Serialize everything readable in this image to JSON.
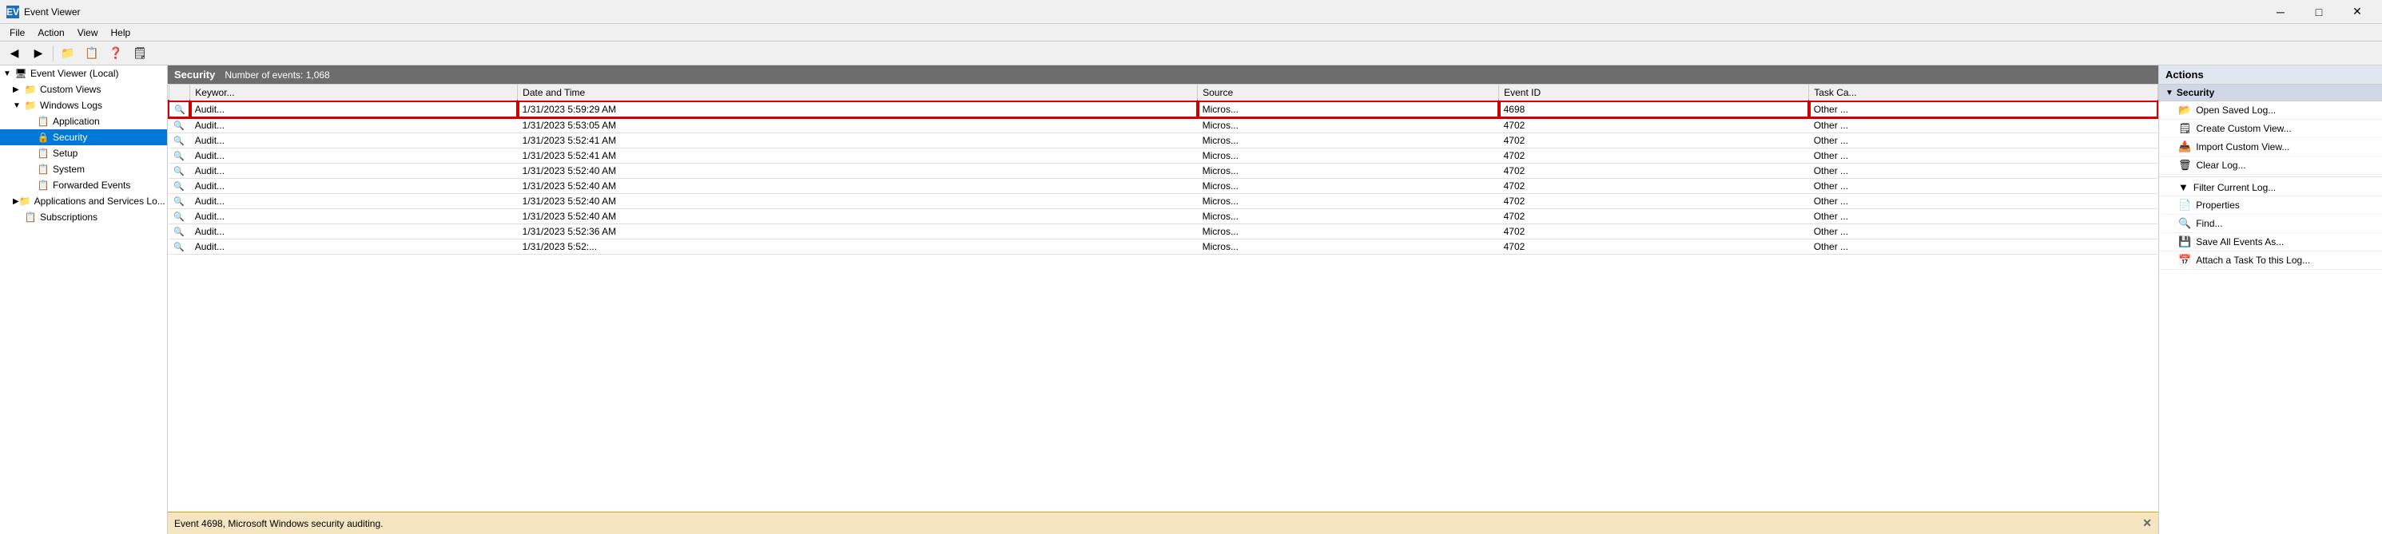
{
  "app": {
    "title": "Event Viewer",
    "icon": "EV"
  },
  "titlebar": {
    "minimize_label": "─",
    "maximize_label": "□",
    "close_label": "✕"
  },
  "menu": {
    "items": [
      "File",
      "Action",
      "View",
      "Help"
    ]
  },
  "toolbar": {
    "buttons": [
      "◀",
      "▶",
      "📁",
      "📋",
      "❓",
      "🗒"
    ]
  },
  "tree": {
    "root": "Event Viewer (Local)",
    "items": [
      {
        "id": "event-viewer-root",
        "label": "Event Viewer (Local)",
        "level": 0,
        "icon": "🖥",
        "expanded": true
      },
      {
        "id": "custom-views",
        "label": "Custom Views",
        "level": 1,
        "icon": "📁",
        "expanded": false
      },
      {
        "id": "windows-logs",
        "label": "Windows Logs",
        "level": 1,
        "icon": "📁",
        "expanded": true
      },
      {
        "id": "application",
        "label": "Application",
        "level": 2,
        "icon": "📋",
        "expanded": false
      },
      {
        "id": "security",
        "label": "Security",
        "level": 2,
        "icon": "🔒",
        "expanded": false,
        "selected": true
      },
      {
        "id": "setup",
        "label": "Setup",
        "level": 2,
        "icon": "📋",
        "expanded": false
      },
      {
        "id": "system",
        "label": "System",
        "level": 2,
        "icon": "📋",
        "expanded": false
      },
      {
        "id": "forwarded-events",
        "label": "Forwarded Events",
        "level": 2,
        "icon": "📋",
        "expanded": false
      },
      {
        "id": "applications-services",
        "label": "Applications and Services Lo...",
        "level": 1,
        "icon": "📁",
        "expanded": false
      },
      {
        "id": "subscriptions",
        "label": "Subscriptions",
        "level": 1,
        "icon": "📋",
        "expanded": false
      }
    ]
  },
  "events_panel": {
    "title": "Security",
    "count_label": "Number of events: 1,068"
  },
  "table": {
    "columns": [
      "Keywor...",
      "Date and Time",
      "Source",
      "Event ID",
      "Task Ca..."
    ],
    "rows": [
      {
        "keyword": "Audit...",
        "datetime": "1/31/2023 5:59:29 AM",
        "source": "Micros...",
        "eventid": "4698",
        "taskcat": "Other ...",
        "selected": true
      },
      {
        "keyword": "Audit...",
        "datetime": "1/31/2023 5:53:05 AM",
        "source": "Micros...",
        "eventid": "4702",
        "taskcat": "Other ...",
        "selected": false
      },
      {
        "keyword": "Audit...",
        "datetime": "1/31/2023 5:52:41 AM",
        "source": "Micros...",
        "eventid": "4702",
        "taskcat": "Other ...",
        "selected": false
      },
      {
        "keyword": "Audit...",
        "datetime": "1/31/2023 5:52:41 AM",
        "source": "Micros...",
        "eventid": "4702",
        "taskcat": "Other ...",
        "selected": false
      },
      {
        "keyword": "Audit...",
        "datetime": "1/31/2023 5:52:40 AM",
        "source": "Micros...",
        "eventid": "4702",
        "taskcat": "Other ...",
        "selected": false
      },
      {
        "keyword": "Audit...",
        "datetime": "1/31/2023 5:52:40 AM",
        "source": "Micros...",
        "eventid": "4702",
        "taskcat": "Other ...",
        "selected": false
      },
      {
        "keyword": "Audit...",
        "datetime": "1/31/2023 5:52:40 AM",
        "source": "Micros...",
        "eventid": "4702",
        "taskcat": "Other ...",
        "selected": false
      },
      {
        "keyword": "Audit...",
        "datetime": "1/31/2023 5:52:40 AM",
        "source": "Micros...",
        "eventid": "4702",
        "taskcat": "Other ...",
        "selected": false
      },
      {
        "keyword": "Audit...",
        "datetime": "1/31/2023 5:52:36 AM",
        "source": "Micros...",
        "eventid": "4702",
        "taskcat": "Other ...",
        "selected": false
      },
      {
        "keyword": "Audit...",
        "datetime": "1/31/2023 5:52:...",
        "source": "Micros...",
        "eventid": "4702",
        "taskcat": "Other ...",
        "selected": false
      }
    ]
  },
  "status_bar": {
    "text": "Event 4698, Microsoft Windows security auditing.",
    "close_icon": "✕"
  },
  "actions": {
    "header": "Actions",
    "section_title": "Security",
    "items": [
      {
        "id": "open-saved-log",
        "label": "Open Saved Log...",
        "icon": "📂"
      },
      {
        "id": "create-custom-view",
        "label": "Create Custom View...",
        "icon": "▼"
      },
      {
        "id": "import-custom-view",
        "label": "Import Custom View...",
        "icon": ""
      },
      {
        "id": "clear-log",
        "label": "Clear Log...",
        "icon": ""
      },
      {
        "id": "filter-current-log",
        "label": "Filter Current Log...",
        "icon": "▼"
      },
      {
        "id": "properties",
        "label": "Properties",
        "icon": "📄"
      },
      {
        "id": "find",
        "label": "Find...",
        "icon": "🔍"
      },
      {
        "id": "save-all-events",
        "label": "Save All Events As...",
        "icon": "💾"
      },
      {
        "id": "attach-task",
        "label": "Attach a Task To this Log...",
        "icon": "📅"
      }
    ]
  }
}
